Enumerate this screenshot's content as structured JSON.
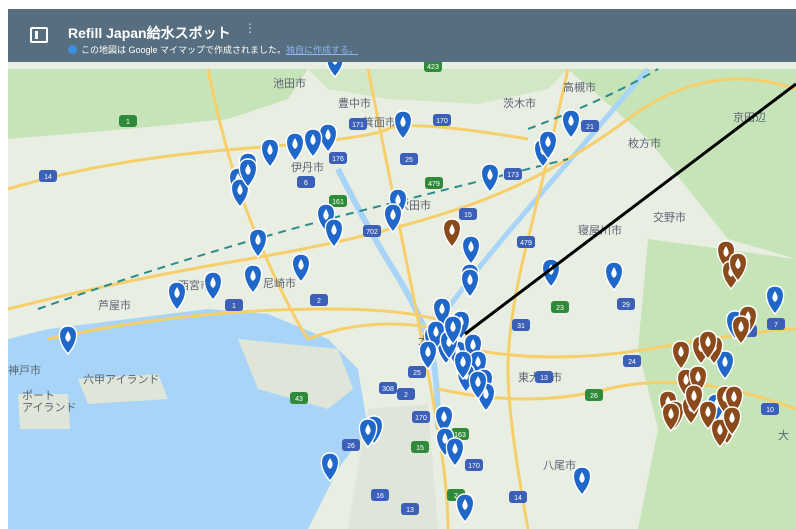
{
  "header": {
    "title": "Refill Japan給水スポット",
    "subtitle": "この地図は Google マイマップで作成されました。",
    "subtitle_link": "独自に作成する。"
  },
  "colors": {
    "header_bg": "#566e7f",
    "water": "#a8d5f7",
    "land": "#e9eee3",
    "green": "#c7e4b8",
    "highway": "#f7cf6a",
    "pin_blue": "#1f67c9",
    "pin_brown": "#8b4a1c"
  },
  "map": {
    "labels": {
      "takatsuki": "高槻市",
      "hirakata": "枚方市",
      "katano": "交野市",
      "neyagawa": "寝屋川市",
      "itami": "伊丹市",
      "amagasaki": "尼崎市",
      "higashiosaka": "東大阪市",
      "kobe": "神戸市",
      "rokko_island": "六甲アイランド",
      "port_island": "ポート\nアイランド",
      "ikeda": "池田市",
      "minoh": "箕面市",
      "suita": "吹田市",
      "toyonaka": "豊中市",
      "ibaraki": "茨木市",
      "kyotanabe": "京田辺",
      "yao": "八尾市",
      "osaka": "大阪",
      "nishinomiya": "西宮市",
      "ashiya": "芦屋市",
      "otake": "大"
    },
    "route_shields": [
      "423",
      "170",
      "171",
      "176",
      "479",
      "173",
      "1",
      "2",
      "43",
      "2",
      "25",
      "308",
      "163",
      "170",
      "14",
      "24",
      "26",
      "29",
      "31",
      "13",
      "15",
      "16",
      "25",
      "479",
      "161",
      "6",
      "702",
      "14",
      "1",
      "10",
      "7",
      "3",
      "2",
      "13",
      "26",
      "170",
      "23",
      "15",
      "21"
    ],
    "blue_pin_count": 58,
    "brown_pin_count": 23
  }
}
